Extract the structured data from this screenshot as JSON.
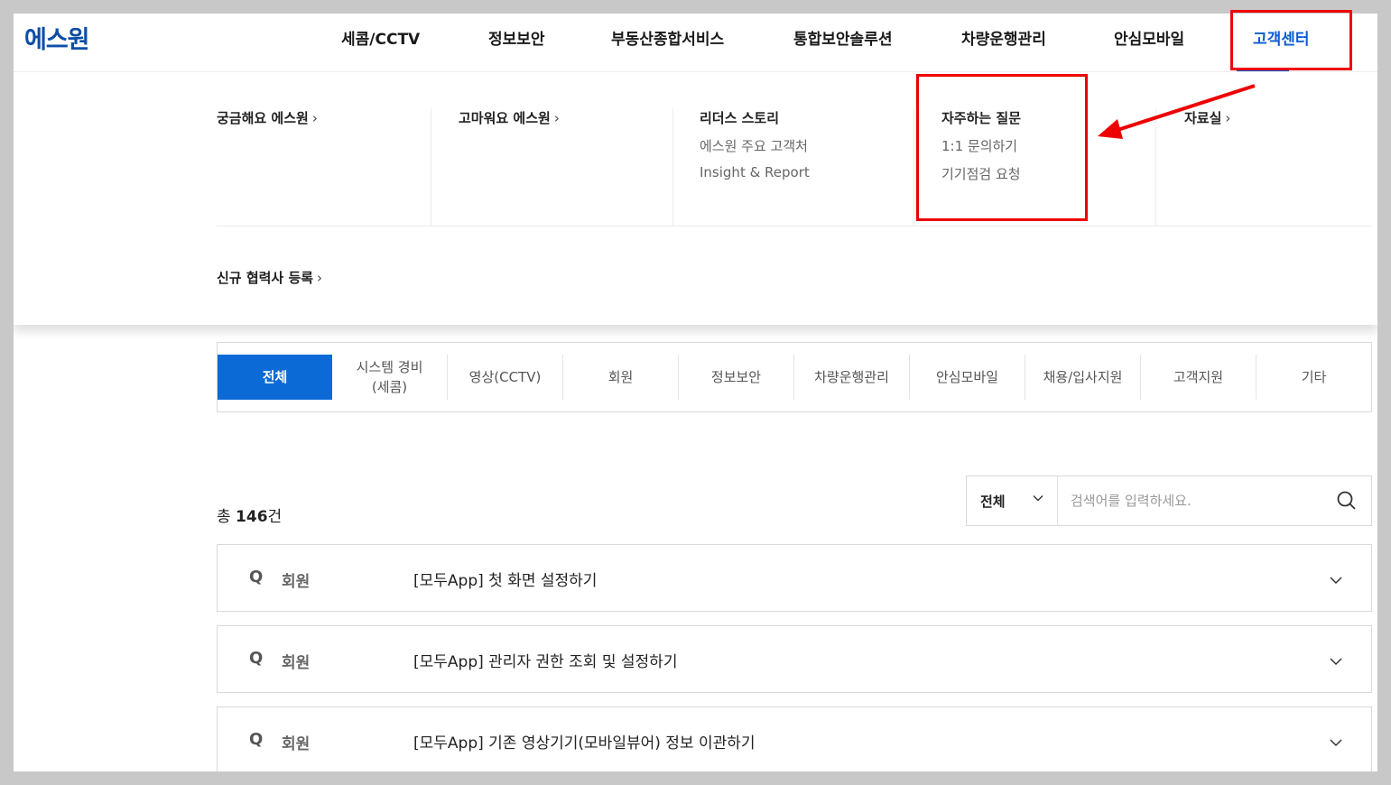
{
  "header": {
    "logo": "에스원",
    "gnb": [
      "세콤/CCTV",
      "정보보안",
      "부동산종합서비스",
      "통합보안솔루션",
      "차량운행관리",
      "안심모바일",
      "고객센터"
    ],
    "active_index": 6
  },
  "mega_menu": {
    "columns": [
      {
        "head": "궁금해요 에스원",
        "subs": []
      },
      {
        "head": "고마워요 에스원",
        "subs": []
      },
      {
        "head": "리더스 스토리",
        "subs": [
          "에스원 주요 고객처",
          "Insight & Report"
        ]
      },
      {
        "head": "자주하는 질문",
        "subs": [
          "1:1 문의하기",
          "기기점검 요청"
        ]
      },
      {
        "head": "자료실",
        "subs": []
      }
    ],
    "bottom": "신규 협력사 등록"
  },
  "tabs": [
    "전체",
    "시스템 경비\n(세콤)",
    "영상(CCTV)",
    "회원",
    "정보보안",
    "차량운행관리",
    "안심모바일",
    "채용/입사지원",
    "고객지원",
    "기타"
  ],
  "count": {
    "prefix": "총 ",
    "number": "146",
    "suffix": "건"
  },
  "search": {
    "select_value": "전체",
    "placeholder": "검색어를 입력하세요."
  },
  "faq": [
    {
      "q": "Q",
      "category": "회원",
      "title": "[모두App] 첫 화면 설정하기"
    },
    {
      "q": "Q",
      "category": "회원",
      "title": "[모두App] 관리자 권한 조회 및 설정하기"
    },
    {
      "q": "Q",
      "category": "회원",
      "title": "[모두App] 기존 영상기기(모바일뷰어) 정보 이관하기"
    }
  ],
  "colors": {
    "brand": "#0d4ea6",
    "accent": "#0b6ad6",
    "annotation": "#ee0000"
  }
}
